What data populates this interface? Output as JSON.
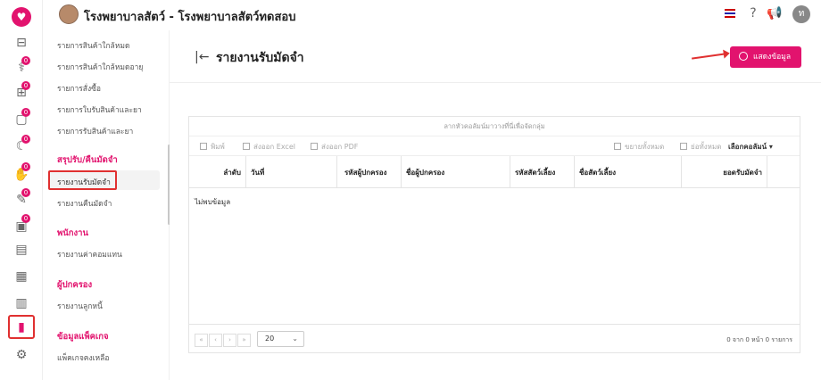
{
  "app": {
    "title": "โรงพยาบาลสัตว์ - โรงพยาบาลสัตว์ทดสอบ",
    "user_initial": "ท",
    "language_flag": "thai-flag",
    "brand_color": "#e2136e"
  },
  "rail": {
    "icons": [
      {
        "name": "heart-logo-icon",
        "glyph": "♥"
      },
      {
        "name": "dumbbell-icon",
        "glyph": "⊟"
      },
      {
        "name": "stethoscope-icon",
        "glyph": "⚕",
        "badge": "0"
      },
      {
        "name": "bed-icon",
        "glyph": "⊞",
        "badge": "0"
      },
      {
        "name": "box-icon",
        "glyph": "▢",
        "badge": "0"
      },
      {
        "name": "moon-icon",
        "glyph": "☾",
        "badge": "0"
      },
      {
        "name": "hand-icon",
        "glyph": "✋",
        "badge": "0"
      },
      {
        "name": "syringe-icon",
        "glyph": "✎",
        "badge": "0"
      },
      {
        "name": "folder-icon",
        "glyph": "▣",
        "badge": "0"
      },
      {
        "name": "cash-register-icon",
        "glyph": "▤"
      },
      {
        "name": "package-icon",
        "glyph": "▦"
      },
      {
        "name": "grid-icon",
        "glyph": "▥"
      },
      {
        "name": "report-chart-icon",
        "glyph": "▮"
      },
      {
        "name": "settings-icon",
        "glyph": "⚙"
      }
    ]
  },
  "sidebar": {
    "items_top": [
      "รายการสินค้าใกล้หมด",
      "รายการสินค้าใกล้หมดอายุ",
      "รายการสั่งซื้อ",
      "รายการใบรับสินค้าและยา",
      "รายการรับสินค้าและยา"
    ],
    "group_deposit": "สรุปรับ/คืนมัดจำ",
    "deposit_items": [
      "รายงานรับมัดจำ",
      "รายงานคืนมัดจำ"
    ],
    "group_staff": "พนักงาน",
    "staff_items": [
      "รายงานค่าคอมแทน"
    ],
    "group_owner": "ผู้ปกครอง",
    "owner_items": [
      "รายงานลูกหนี้"
    ],
    "group_package": "ข้อมูลแพ็คเกจ",
    "package_items": [
      "แพ็คเกจคงเหลือ"
    ]
  },
  "main": {
    "page_title": "รายงานรับมัดจำ",
    "show_button": "แสดงข้อมูล",
    "grid": {
      "group_hint": "ลากหัวคอลัมน์มาวางที่นี่เพื่อจัดกลุ่ม",
      "toolbar": {
        "print": "พิมพ์",
        "export_excel": "ส่งออก Excel",
        "export_pdf": "ส่งออก PDF",
        "expand_all": "ขยายทั้งหมด",
        "collapse_all": "ย่อทั้งหมด",
        "choose_columns": "เลือกคอลัมน์"
      },
      "columns": [
        "ลำดับ",
        "วันที่",
        "รหัสผู้ปกครอง",
        "ชื่อผู้ปกครอง",
        "รหัสสัตว์เลี้ยง",
        "ชื่อสัตว์เลี้ยง",
        "ยอดรับมัดจำ"
      ],
      "empty_text": "ไม่พบข้อมูล",
      "pager": {
        "page_size": "20",
        "info": "0 จาก 0 หน้า 0 รายการ"
      }
    }
  }
}
